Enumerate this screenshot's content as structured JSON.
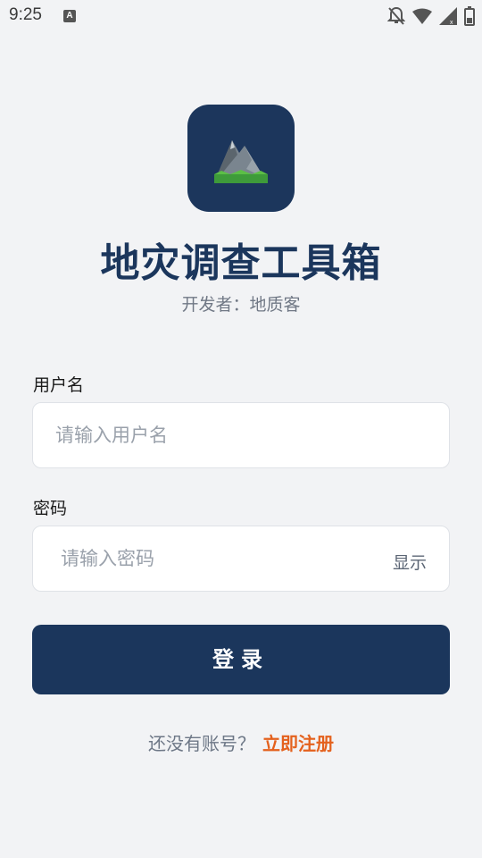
{
  "status_bar": {
    "time": "9:25",
    "notification_badge": "A",
    "icons": [
      "notifications-off-icon",
      "wifi-icon",
      "signal-icon",
      "battery-icon"
    ]
  },
  "app": {
    "title": "地灾调查工具箱",
    "developer": "开发者：地质客",
    "logo_icon": "mountain-icon"
  },
  "form": {
    "username_label": "用户名",
    "username_placeholder": "请输入用户名",
    "username_value": "",
    "password_label": "密码",
    "password_placeholder": "请输入密码",
    "password_value": "",
    "show_password_label": "显示",
    "login_button": "登录"
  },
  "footer": {
    "register_prompt": "还没有账号？",
    "register_link": "立即注册"
  },
  "colors": {
    "primary": "#1b365c",
    "accent": "#e4611d",
    "background": "#f2f3f5"
  }
}
